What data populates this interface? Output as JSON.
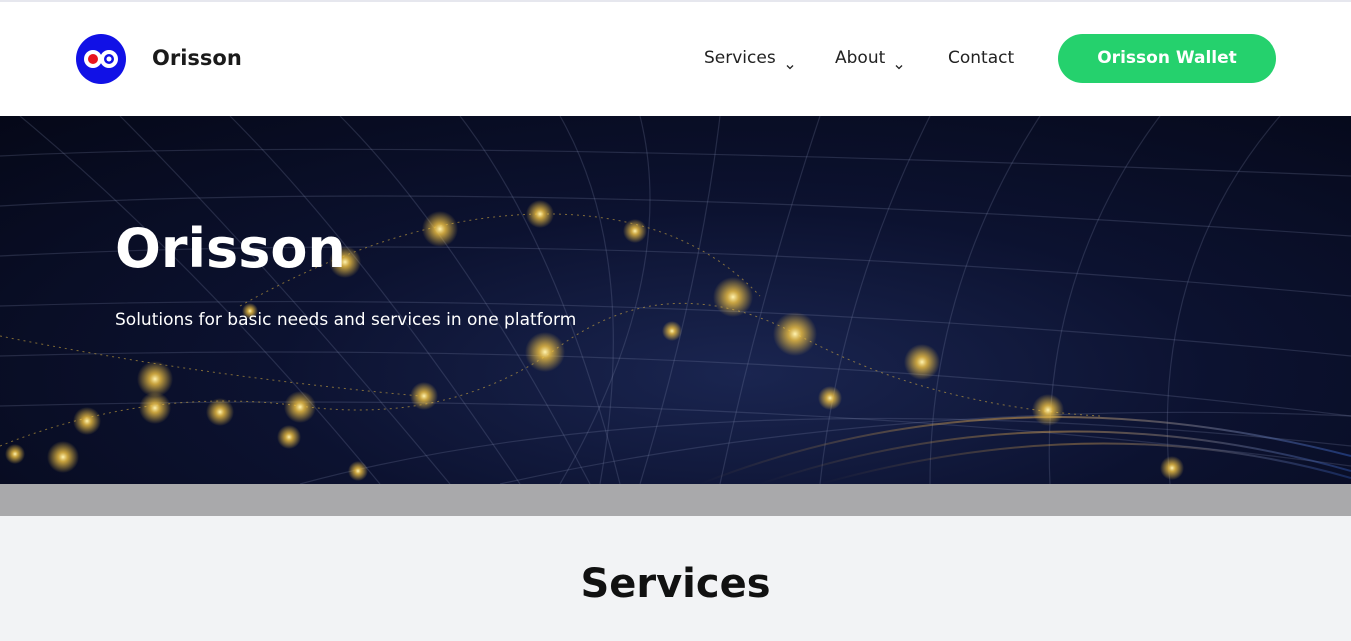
{
  "header": {
    "brand": "Orisson",
    "logo_icon": "orisson-logo-icon",
    "nav": {
      "services": "Services",
      "about": "About",
      "contact": "Contact"
    },
    "cta_label": "Orisson Wallet"
  },
  "hero": {
    "title": "Orisson",
    "subtitle": "Solutions for basic needs and services in one platform"
  },
  "services": {
    "heading": "Services"
  },
  "colors": {
    "logo_blue": "#1111e6",
    "logo_red": "#e8141e",
    "cta_green": "#25d16d",
    "hero_dark": "#0c1230",
    "glow_gold": "#f5c542",
    "band_gray": "#a9a9ab",
    "section_bg": "#f2f3f5"
  }
}
